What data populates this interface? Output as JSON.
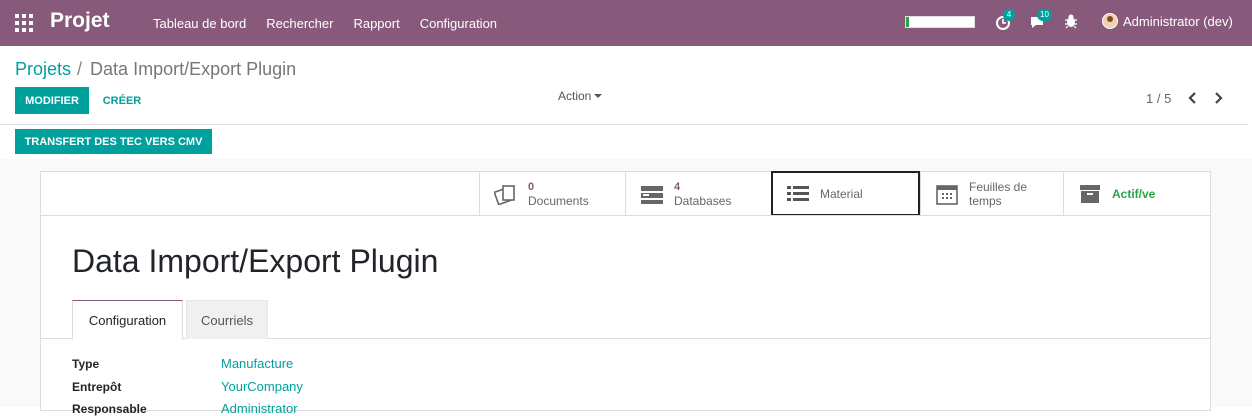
{
  "navbar": {
    "app_name": "Projet",
    "menu": [
      "Tableau de bord",
      "Rechercher",
      "Rapport",
      "Configuration"
    ],
    "progress": 0.05,
    "activity_badge": "4",
    "messages_badge": "10",
    "user": "Administrator (dev)"
  },
  "breadcrumb": {
    "parent": "Projets",
    "separator": "/",
    "current": "Data Import/Export Plugin"
  },
  "buttons": {
    "modifier": "MODIFIER",
    "creer": "CRÉER",
    "action": "Action",
    "transfert": "TRANSFERT DES TEC VERS CMV"
  },
  "pager": {
    "value": "1 / 5"
  },
  "smart_buttons": [
    {
      "num": "0",
      "label": "Documents",
      "icon": "documents-icon"
    },
    {
      "num": "4",
      "label": "Databases",
      "icon": "database-icon"
    },
    {
      "num": "",
      "label": "Material",
      "icon": "list-icon"
    },
    {
      "num": "",
      "label": "Feuilles de temps",
      "icon": "calendar-icon"
    },
    {
      "num": "",
      "label": "Actif/ve",
      "icon": "archive-icon"
    }
  ],
  "record": {
    "title": "Data Import/Export Plugin"
  },
  "tabs": [
    "Configuration",
    "Courriels"
  ],
  "fields": [
    {
      "label": "Type",
      "value": "Manufacture"
    },
    {
      "label": "Entrepôt",
      "value": "YourCompany"
    },
    {
      "label": "Responsable",
      "value": "Administrator"
    }
  ],
  "colors": {
    "brand": "#875a7b",
    "accent": "#00a09d",
    "active": "#28a745"
  }
}
